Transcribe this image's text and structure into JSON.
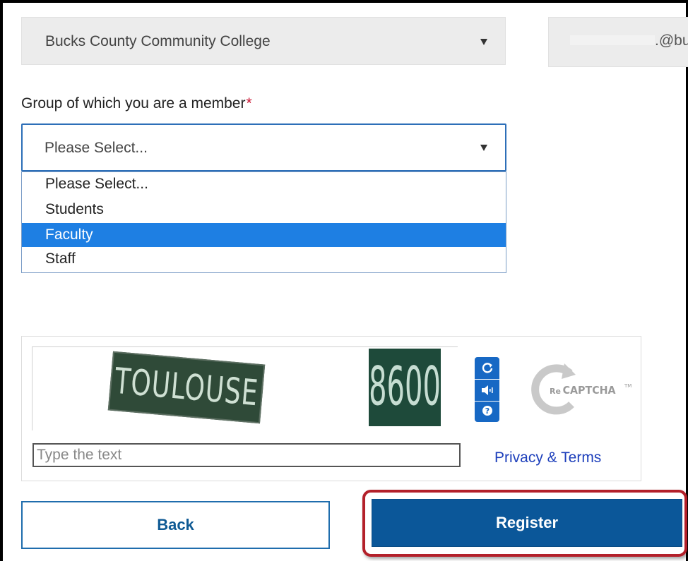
{
  "institution_select": {
    "value": "Bucks County Community College"
  },
  "email_field": {
    "domain_suffix": ".@bu"
  },
  "group": {
    "label": "Group of which you are a member",
    "required_marker": "*",
    "selected_value": "Please Select...",
    "options": [
      "Please Select...",
      "Students",
      "Faculty",
      "Staff"
    ],
    "highlighted_option": "Faculty"
  },
  "captcha": {
    "word1": "TOULOUSE",
    "word2": "8600",
    "input_placeholder": "Type the text",
    "privacy_link": "Privacy & Terms",
    "logo_re": "Re",
    "logo_text": "CAPTCHA",
    "logo_tm": "TM",
    "controls": [
      "refresh-icon",
      "audio-icon",
      "help-icon"
    ]
  },
  "actions": {
    "back_label": "Back",
    "register_label": "Register"
  },
  "colors": {
    "primary_blue": "#0b5799",
    "highlight_blue": "#1e7fe3",
    "required_red": "#c8102e",
    "annotation_red": "#b3202a"
  }
}
